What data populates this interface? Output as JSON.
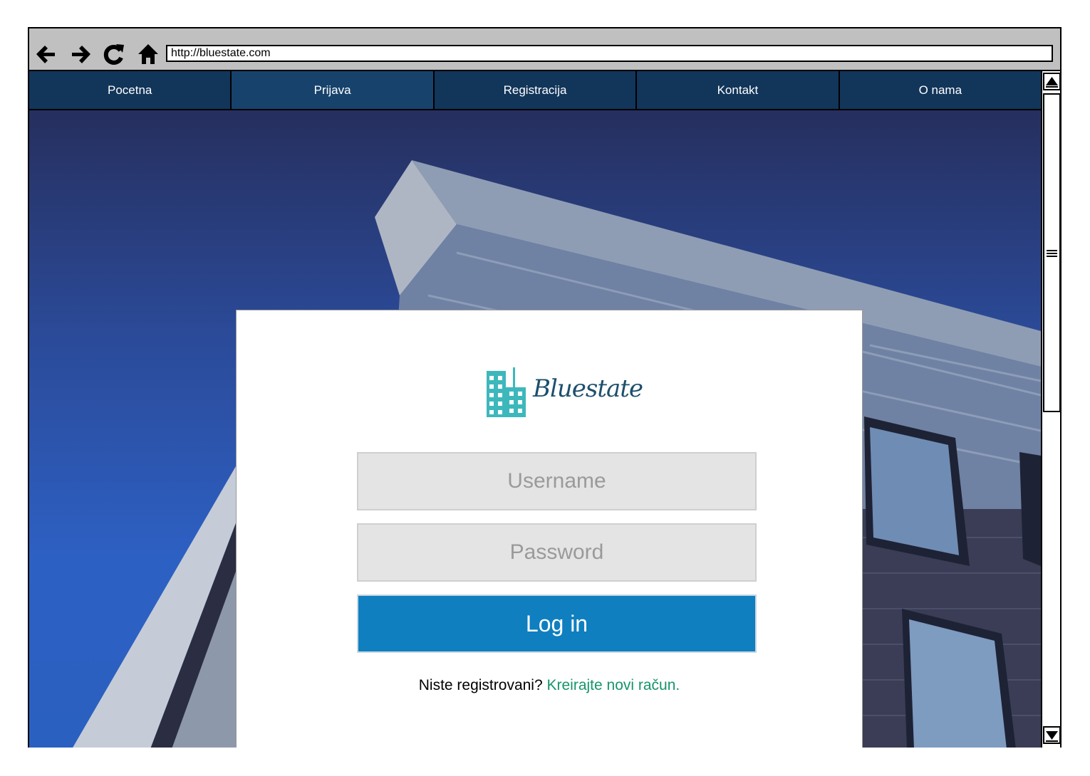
{
  "browser": {
    "url": "http://bluestate.com"
  },
  "nav": {
    "items": [
      {
        "label": "Pocetna"
      },
      {
        "label": "Prijava"
      },
      {
        "label": "Registracija"
      },
      {
        "label": "Kontakt"
      },
      {
        "label": "O nama"
      }
    ],
    "active": "Prijava"
  },
  "login": {
    "logo_text": "Bluestate",
    "username_placeholder": "Username",
    "password_placeholder": "Password",
    "login_label": "Log in",
    "register_prompt": "Niste registrovani?",
    "register_link": "Kreirajte novi račun."
  },
  "colors": {
    "nav_bg": "#12355a",
    "button_blue": "#0f7fbf",
    "link_green": "#16956a",
    "logo_teal": "#3cb8bc"
  },
  "icons": [
    "back-arrow-icon",
    "forward-arrow-icon",
    "reload-icon",
    "home-icon",
    "buildings-logo-icon",
    "scroll-up-icon",
    "scroll-down-icon",
    "grip-icon"
  ]
}
